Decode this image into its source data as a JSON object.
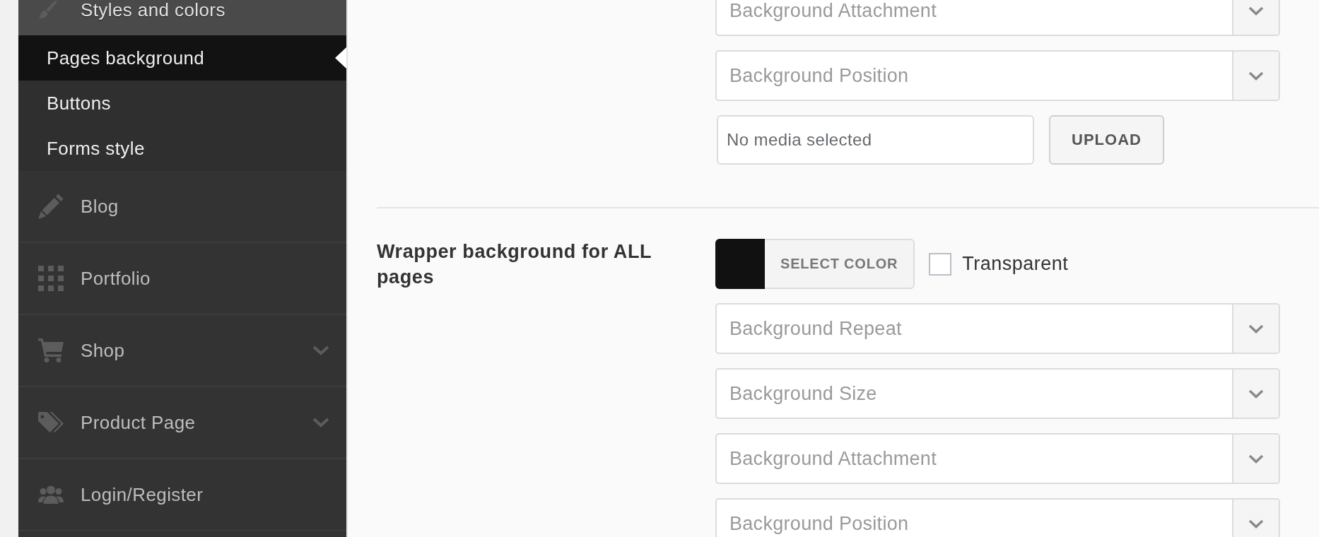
{
  "sidebar": {
    "items": [
      {
        "label": "Styles and colors",
        "expanded": true,
        "children": [
          {
            "label": "Pages background",
            "selected": true
          },
          {
            "label": "Buttons",
            "selected": false
          },
          {
            "label": "Forms style",
            "selected": false
          }
        ]
      },
      {
        "label": "Blog"
      },
      {
        "label": "Portfolio"
      },
      {
        "label": "Shop",
        "expanded": false
      },
      {
        "label": "Product Page",
        "expanded": false
      },
      {
        "label": "Login/Register"
      }
    ]
  },
  "sections": [
    {
      "fields": [
        {
          "kind": "select",
          "placeholder": "Background Attachment"
        },
        {
          "kind": "select",
          "placeholder": "Background Position"
        },
        {
          "kind": "media",
          "value": "No media selected",
          "button": "UPLOAD"
        }
      ]
    },
    {
      "label": "Wrapper background for ALL pages",
      "fields": [
        {
          "kind": "color",
          "color": "#111111",
          "button": "SELECT COLOR",
          "transparent": {
            "label": "Transparent",
            "checked": false
          }
        },
        {
          "kind": "select",
          "placeholder": "Background Repeat"
        },
        {
          "kind": "select",
          "placeholder": "Background Size"
        },
        {
          "kind": "select",
          "placeholder": "Background Attachment"
        },
        {
          "kind": "select",
          "placeholder": "Background Position"
        }
      ]
    }
  ]
}
